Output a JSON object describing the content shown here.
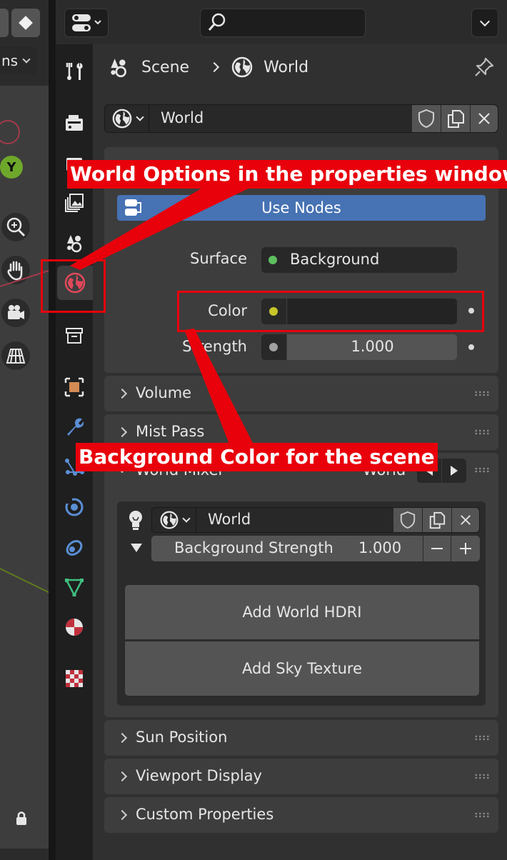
{
  "viewport": {
    "mode_label": "ns",
    "gizmo_y_label": "Y"
  },
  "breadcrumb": {
    "scene": "Scene",
    "world": "World"
  },
  "world_selector": {
    "name": "World"
  },
  "surface_panel": {
    "use_nodes_label": "Use Nodes",
    "surface_label": "Surface",
    "surface_value": "Background",
    "color_label": "Color",
    "color_value": "",
    "strength_label": "Strength",
    "strength_value": "1.000"
  },
  "panels": {
    "volume": "Volume",
    "mist_pass": "Mist Pass",
    "world_mixer": "World Mixer",
    "world_mixer_right": "World",
    "sun_position": "Sun Position",
    "viewport_display": "Viewport Display",
    "custom_properties": "Custom Properties"
  },
  "world_mixer": {
    "world_name": "World",
    "bg_strength_label": "Background Strength",
    "bg_strength_value": "1.000",
    "add_hdri_label": "Add World HDRI",
    "add_sky_label": "Add Sky Texture"
  },
  "annotations": {
    "world_options": "World Options in the properties window",
    "background_color": "Background Color for the scene"
  },
  "colors": {
    "accent_blue": "#4772b3",
    "annotation_red": "#e8000b",
    "socket_green": "#5ec05e",
    "socket_yellow": "#c7c729",
    "socket_gray": "#a1a1a1",
    "world_tab_red": "#e0485a"
  }
}
